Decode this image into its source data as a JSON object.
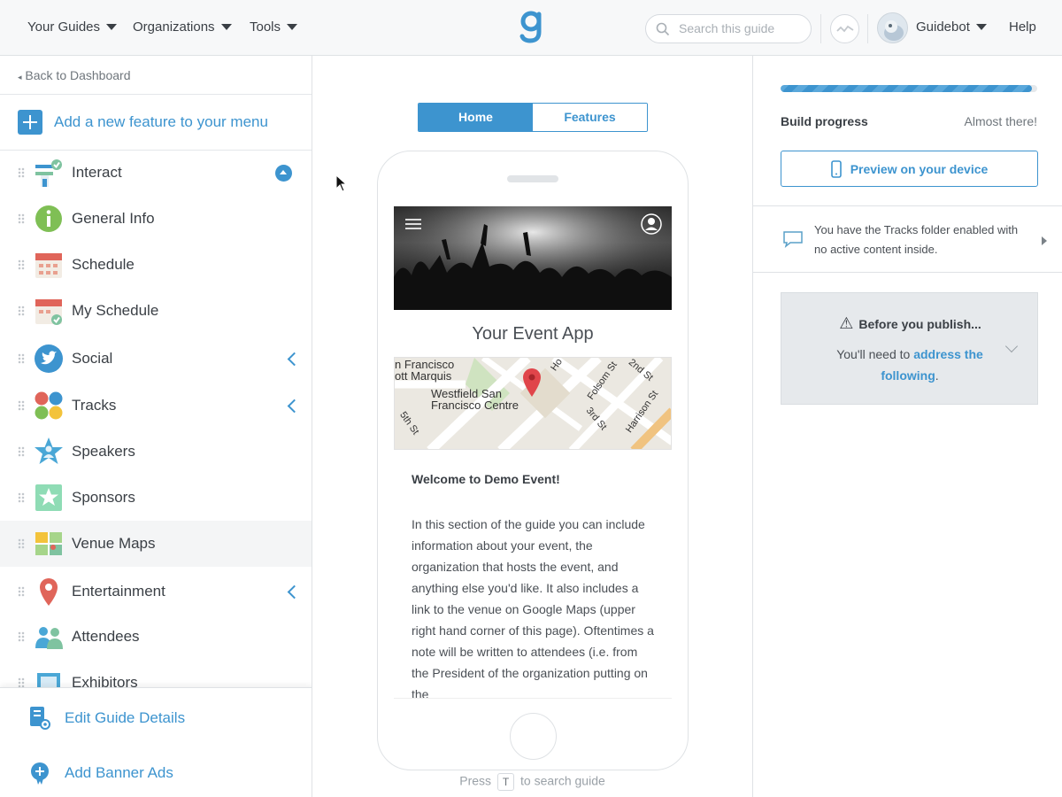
{
  "topnav": {
    "menus": [
      "Your Guides",
      "Organizations",
      "Tools"
    ],
    "search_placeholder": "Search this guide",
    "user_name": "Guidebot",
    "help": "Help"
  },
  "sidebar": {
    "back_link": "Back to Dashboard",
    "add_feature": "Add a new feature to your menu",
    "items": [
      {
        "label": "Interact",
        "icon": "interact-icon"
      },
      {
        "label": "General Info",
        "icon": "info-icon"
      },
      {
        "label": "Schedule",
        "icon": "calendar-icon"
      },
      {
        "label": "My Schedule",
        "icon": "calendar-check-icon"
      },
      {
        "label": "Social",
        "icon": "twitter-icon"
      },
      {
        "label": "Tracks",
        "icon": "tracks-icon"
      },
      {
        "label": "Speakers",
        "icon": "speaker-star-icon"
      },
      {
        "label": "Sponsors",
        "icon": "sponsor-star-icon"
      },
      {
        "label": "Venue Maps",
        "icon": "map-icon"
      },
      {
        "label": "Entertainment",
        "icon": "map-pin-icon"
      },
      {
        "label": "Attendees",
        "icon": "people-icon"
      },
      {
        "label": "Exhibitors",
        "icon": "building-icon"
      }
    ],
    "bottom": {
      "edit_details": "Edit Guide Details",
      "banner_ads": "Add Banner Ads"
    }
  },
  "center": {
    "tabs": [
      "Home",
      "Features"
    ],
    "app_title": "Your Event App",
    "map_labels": [
      "n Francisco",
      "ott Marquis",
      "Westfield San",
      "Francisco Centre",
      "5th St",
      "Folsom St",
      "2nd St",
      "3rd St",
      "Harrison St",
      "Ho"
    ],
    "welcome": "Welcome to Demo Event!",
    "body": "In this section of the guide you can include information about your event, the organization that hosts the event, and anything else you'd like. It also includes a link to the venue on Google Maps (upper right hand corner of this page). Oftentimes a note will be written to attendees (i.e. from the President of the organization putting on the",
    "press_hint_before": "Press",
    "press_key": "T",
    "press_hint_after": "to search guide"
  },
  "right": {
    "progress": 0.98,
    "build_label": "Build progress",
    "build_status": "Almost there!",
    "preview_button": "Preview on your device",
    "notice": "You have the Tracks folder enabled with no active content inside.",
    "publish_title": "Before you publish...",
    "publish_text_before": "You'll need to",
    "publish_link": "address the following",
    "publish_text_after": "."
  },
  "colors": {
    "accent": "#3d94cf"
  }
}
